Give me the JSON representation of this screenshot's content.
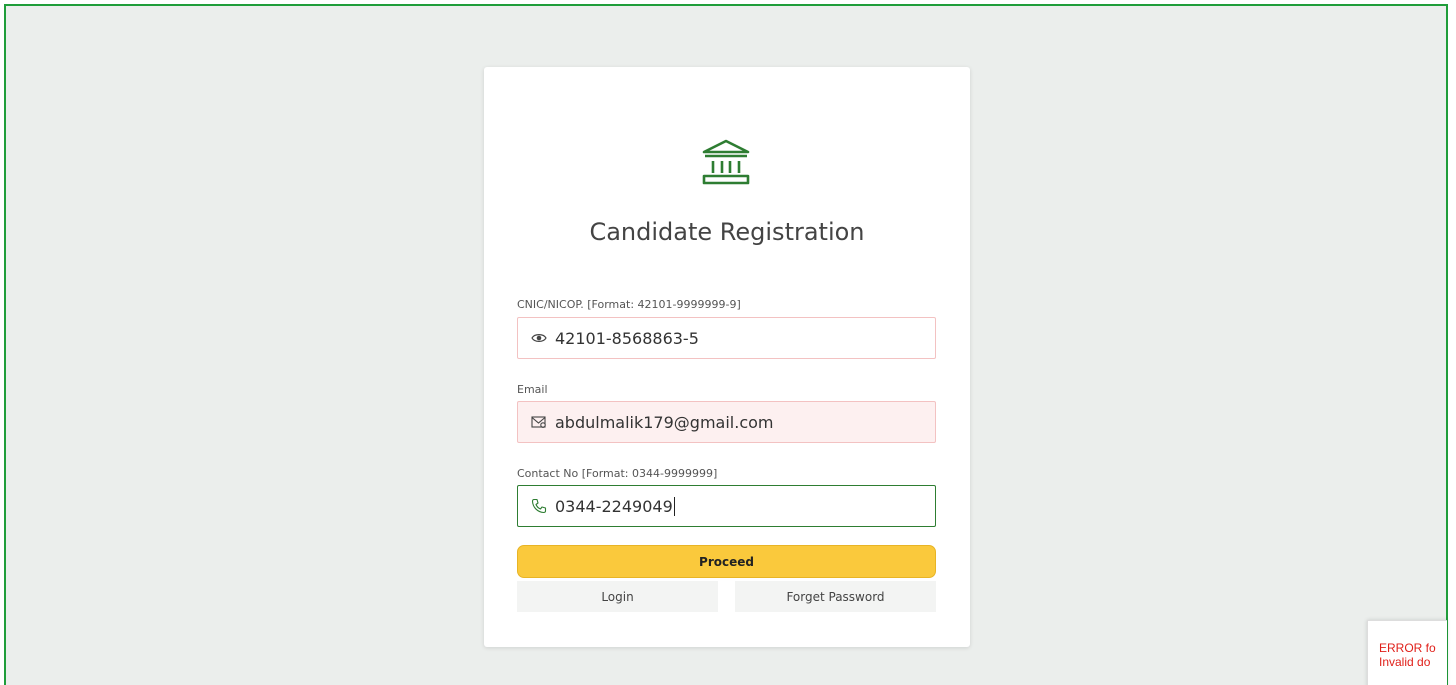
{
  "page": {
    "title": "Candidate Registration"
  },
  "form": {
    "cnic": {
      "label": "CNIC/NICOP. [Format: 42101-9999999-9]",
      "value": "42101-8568863-5",
      "icon": "eye-icon"
    },
    "email": {
      "label": "Email",
      "value": "abdulmalik179@gmail.com",
      "icon": "mail-icon"
    },
    "contact": {
      "label": "Contact No [Format: 0344-9999999]",
      "value": "0344-2249049",
      "icon": "phone-icon"
    }
  },
  "actions": {
    "proceed_label": "Proceed",
    "login_label": "Login",
    "forget_label": "Forget Password"
  },
  "recaptcha": {
    "line1": "ERROR fo",
    "line2": "Invalid do"
  },
  "colors": {
    "accent": "#2e7d32",
    "button": "#fac93c",
    "error": "#e0201a",
    "frame": "#1f9d3a"
  }
}
